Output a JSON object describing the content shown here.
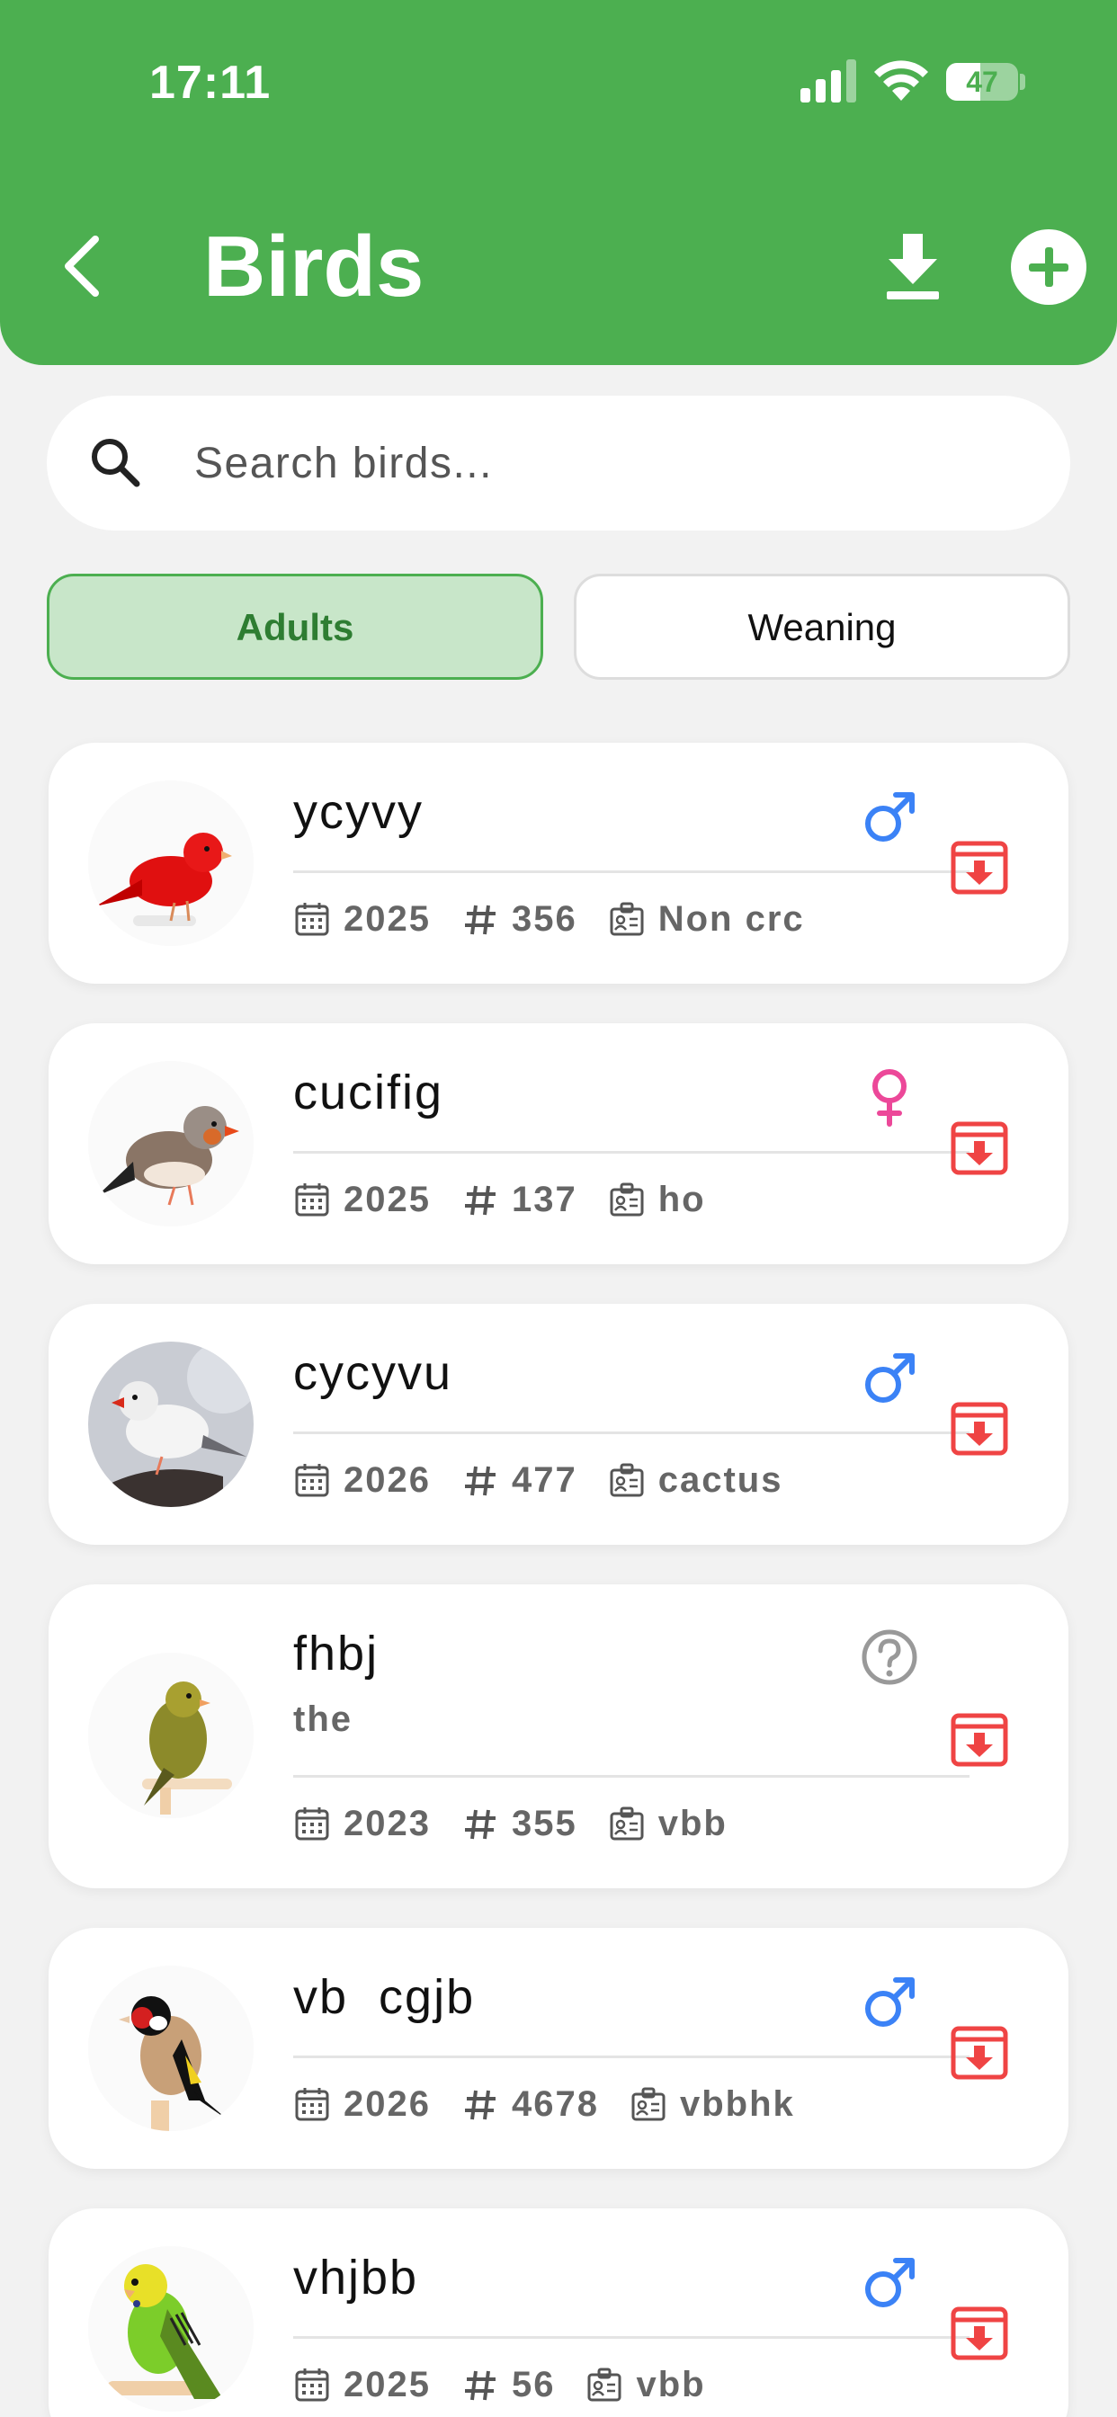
{
  "status_bar": {
    "time": "17:11",
    "battery": "47",
    "battery_level": 0.47
  },
  "header": {
    "title": "Birds"
  },
  "search": {
    "placeholder": "Search birds..."
  },
  "tabs": [
    {
      "label": "Adults",
      "active": true
    },
    {
      "label": "Weaning",
      "active": false
    }
  ],
  "colors": {
    "primary": "#4caf50",
    "tab_active_bg": "#c8e6c9",
    "tab_active_text": "#2e7d32",
    "male": "#3b82f6",
    "female": "#ec4899",
    "unknown": "#999999",
    "archive": "#ef4444"
  },
  "birds": [
    {
      "name": "ycyvy",
      "note": "",
      "year": "2025",
      "number": "356",
      "cage": "Non crc",
      "gender": "male",
      "gender_icon": "male-icon",
      "image": "red-canary"
    },
    {
      "name": "cucifig",
      "note": "",
      "year": "2025",
      "number": "137",
      "cage": "ho",
      "gender": "female",
      "gender_icon": "female-icon",
      "image": "zebra-finch"
    },
    {
      "name": "cycyvu",
      "note": "",
      "year": "2026",
      "number": "477",
      "cage": "cactus",
      "gender": "male",
      "gender_icon": "male-icon",
      "image": "white-zebra-finch"
    },
    {
      "name": "fhbj",
      "note": "the",
      "year": "2023",
      "number": "355",
      "cage": "vbb",
      "gender": "unknown",
      "gender_icon": "question-icon",
      "image": "yellow-canary"
    },
    {
      "name": "vb  cgjb",
      "note": "",
      "year": "2026",
      "number": "4678",
      "cage": "vbbhk",
      "gender": "male",
      "gender_icon": "male-icon",
      "image": "goldfinch"
    },
    {
      "name": "vhjbb",
      "note": "",
      "year": "2025",
      "number": "56",
      "cage": "vbb",
      "gender": "male",
      "gender_icon": "male-icon",
      "image": "budgerigar"
    }
  ]
}
